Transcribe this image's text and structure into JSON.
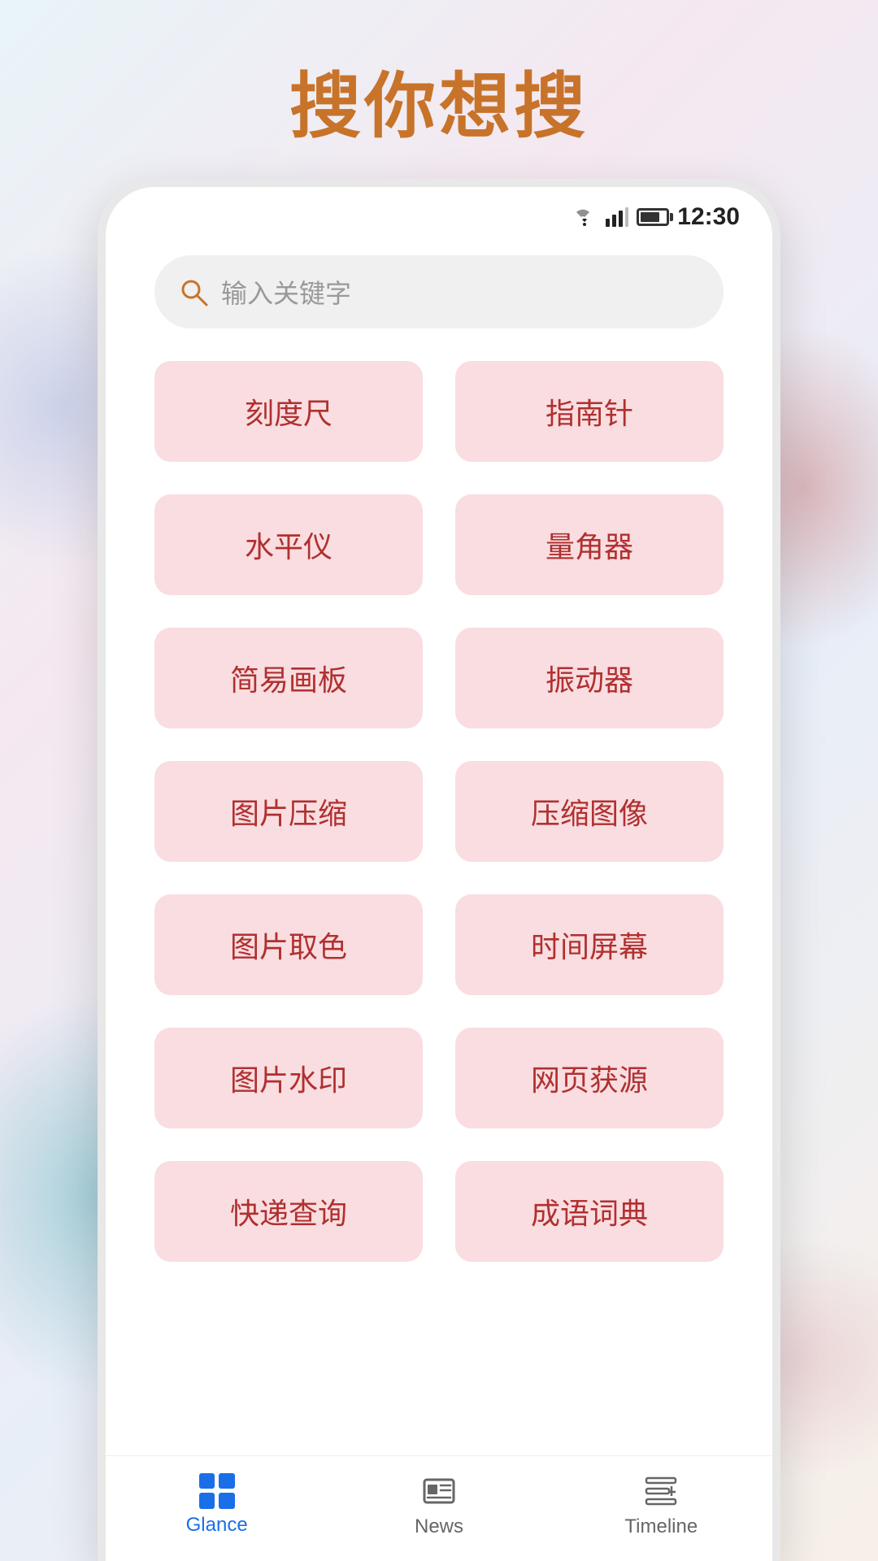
{
  "page": {
    "title": "搜你想搜",
    "title_color": "#c8732a"
  },
  "status_bar": {
    "time": "12:30"
  },
  "search": {
    "placeholder": "输入关键字"
  },
  "tools": [
    [
      "刻度尺",
      "指南针"
    ],
    [
      "水平仪",
      "量角器"
    ],
    [
      "简易画板",
      "振动器"
    ],
    [
      "图片压缩",
      "压缩图像"
    ],
    [
      "图片取色",
      "时间屏幕"
    ],
    [
      "图片水印",
      "网页获源"
    ],
    [
      "快递查询",
      "成语词典"
    ]
  ],
  "bottom_nav": {
    "items": [
      {
        "id": "glance",
        "label": "Glance",
        "active": true
      },
      {
        "id": "news",
        "label": "News",
        "active": false
      },
      {
        "id": "timeline",
        "label": "Timeline",
        "active": false
      }
    ]
  }
}
